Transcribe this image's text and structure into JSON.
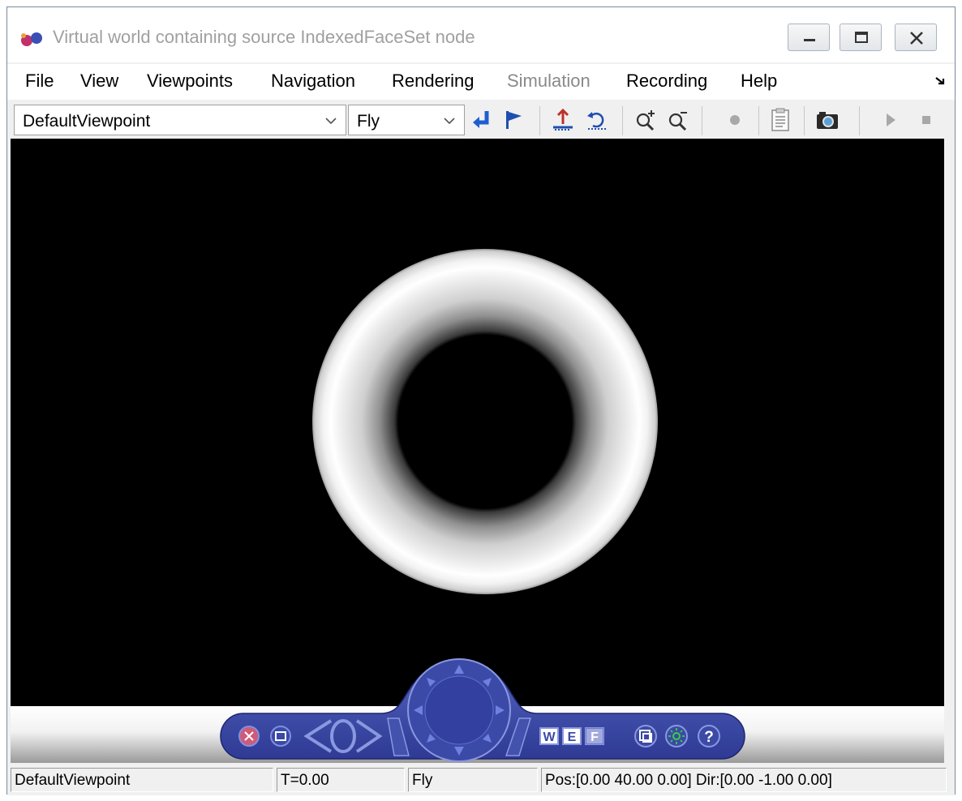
{
  "window": {
    "title": "Virtual world containing source IndexedFaceSet node"
  },
  "menu": {
    "items": [
      {
        "label": "File"
      },
      {
        "label": "View"
      },
      {
        "label": "Viewpoints"
      },
      {
        "label": "Navigation"
      },
      {
        "label": "Rendering"
      },
      {
        "label": "Simulation",
        "disabled": true
      },
      {
        "label": "Recording"
      },
      {
        "label": "Help"
      }
    ]
  },
  "toolbar": {
    "viewpoint_value": "DefaultViewpoint",
    "navigation_value": "Fly",
    "icons": [
      "return-to-viewpoint-icon",
      "create-viewpoint-flag-icon",
      "straighten-up-icon",
      "undo-move-icon",
      "zoom-in-icon",
      "zoom-out-icon",
      "record-icon",
      "capture-frame-icon",
      "snapshot-camera-icon",
      "play-icon",
      "stop-icon"
    ]
  },
  "navpanel": {
    "w_label": "W",
    "e_label": "E",
    "f_label": "F",
    "help_label": "?",
    "icons": [
      "close-panel-icon",
      "minimize-panel-icon",
      "slide-left-icon",
      "rotate-icon",
      "slide-right-icon",
      "compass-wheel-icon",
      "fullscreen-icon",
      "headlight-icon",
      "help-icon"
    ]
  },
  "statusbar": {
    "viewpoint": "DefaultViewpoint",
    "time": "T=0.00",
    "mode": "Fly",
    "position": "Pos:[0.00 40.00 0.00] Dir:[0.00 -1.00 0.00]"
  },
  "colors": {
    "navpanel_blue": "#3b4aa6",
    "title_text_gray": "#a0a0a0",
    "viewport_bg": "#000000"
  }
}
